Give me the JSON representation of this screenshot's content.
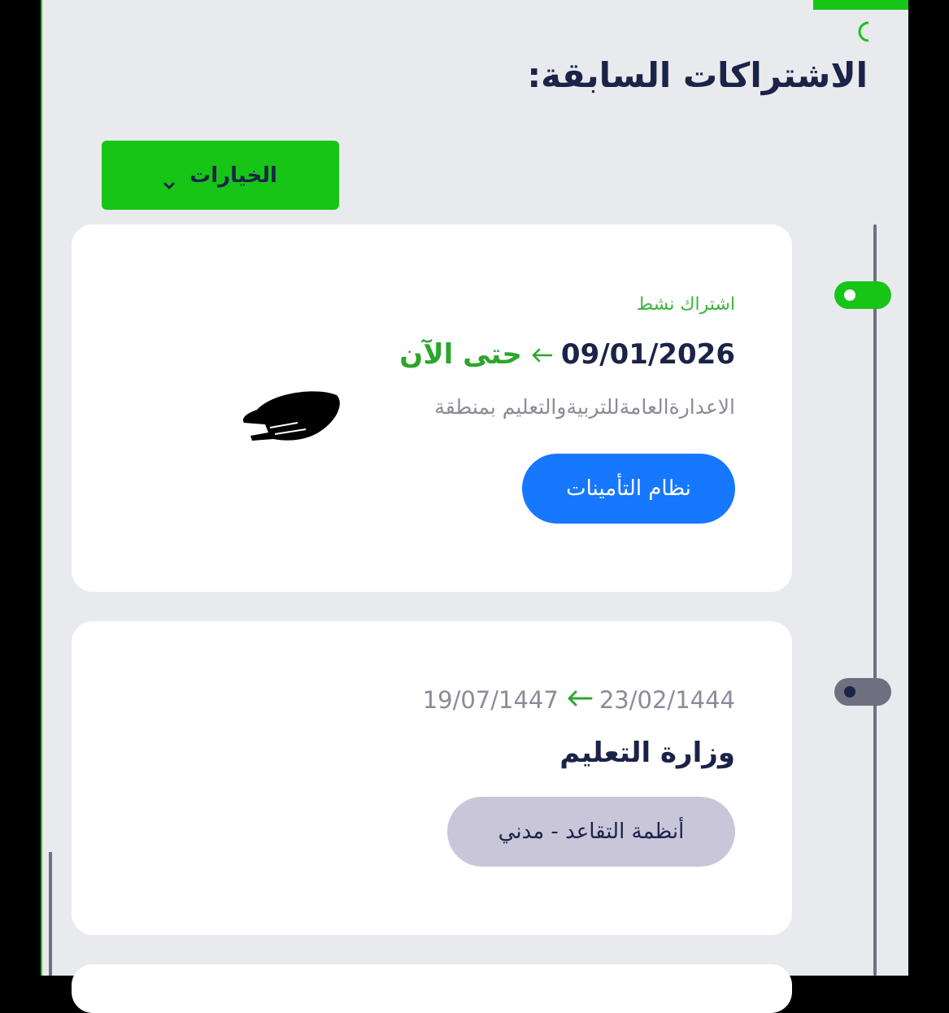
{
  "header": {
    "title": "الاشتراكات السابقة:"
  },
  "options": {
    "label": "الخيارات",
    "icon": "chevron-down-icon"
  },
  "subscriptions": [
    {
      "status": "اشتراك نشط",
      "start_date": "09/01/2026",
      "end_date": "حتى الآن",
      "employer": "الاعدارةالعامةللتربيةوالتعليم بمنطقة",
      "system": "نظام التأمينات",
      "active": true
    },
    {
      "start_date": "23/02/1444",
      "end_date": "19/07/1447",
      "employer": "وزارة التعليم",
      "system": "أنظمة التقاعد - مدني",
      "active": false
    }
  ],
  "colors": {
    "brand_green": "#16c516",
    "accent_blue": "#1677ff",
    "title_navy": "#1b2348",
    "pill_gray": "#c9c6da",
    "background": "#e9eaee"
  }
}
